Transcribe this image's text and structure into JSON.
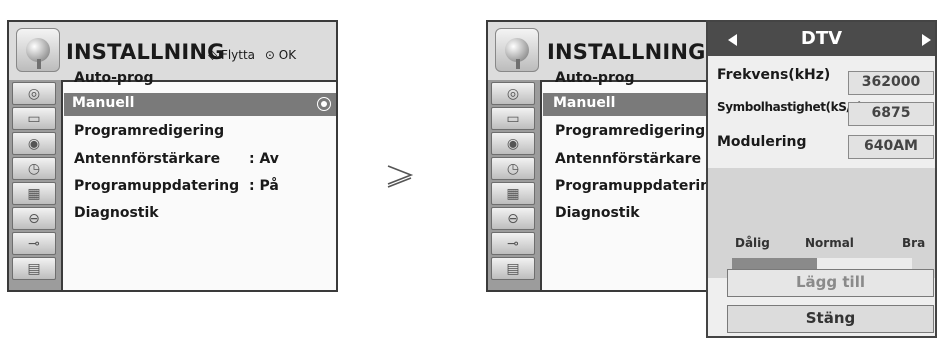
{
  "menu_title": "INSTALLNING",
  "hint": {
    "move_label": "Flytta",
    "ok_label": "OK"
  },
  "menu_items": [
    {
      "label": "Auto-prog",
      "value": ""
    },
    {
      "label": "Manuell",
      "value": ""
    },
    {
      "label": "Programredigering",
      "value": ""
    },
    {
      "label": "Antennförstärkare",
      "value": ": Av"
    },
    {
      "label": "Programuppdatering",
      "value": ": På"
    },
    {
      "label": "Diagnostik",
      "value": ""
    }
  ],
  "selected_index": 1,
  "category_icons": [
    "satellite-icon",
    "tv-icon",
    "speaker-icon",
    "clock-icon",
    "calendar-icon",
    "lock-icon",
    "input-icon",
    "clapperboard-icon"
  ],
  "separator_glyph": "≥",
  "popup": {
    "source": "DTV",
    "fields": [
      {
        "label": "Frekvens(kHz)",
        "value": "362000"
      },
      {
        "label": "Symbolhastighet(kS/s)",
        "value": "6875"
      },
      {
        "label": "Modulering",
        "value": "640AM"
      }
    ],
    "signal": {
      "labels": [
        "Dålig",
        "Normal",
        "Bra"
      ],
      "level_fraction": 0.47
    },
    "add_button": "Lägg till",
    "close_button": "Stäng"
  }
}
